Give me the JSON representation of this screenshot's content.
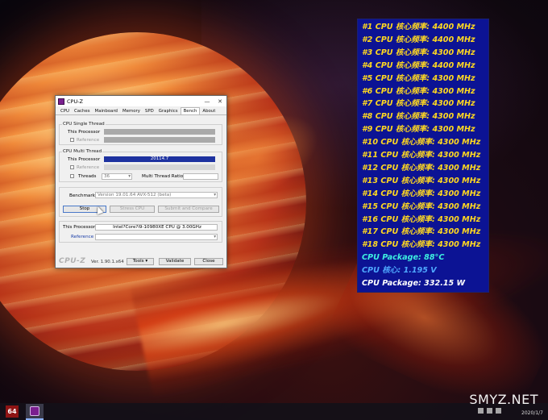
{
  "cpuz": {
    "title": "CPU-Z",
    "tabs": [
      "CPU",
      "Caches",
      "Mainboard",
      "Memory",
      "SPD",
      "Graphics",
      "Bench",
      "About"
    ],
    "active_tab": "Bench",
    "single_thread": {
      "group_title": "CPU Single Thread",
      "this_processor_label": "This Processor",
      "reference_label": "Reference"
    },
    "multi_thread": {
      "group_title": "CPU Multi Thread",
      "this_processor_label": "This Processor",
      "this_processor_value": "20114.7",
      "reference_label": "Reference",
      "threads_label": "Threads",
      "threads_value": "36",
      "ratio_label": "Multi Thread Ratio"
    },
    "benchmark_label": "Benchmark",
    "benchmark_value": "Version 19.01.64 AVX-512 (beta)",
    "stop_button": "Stop",
    "stress_button": "Stress CPU",
    "submit_button": "Submit and Compare",
    "processor_label": "This Processor",
    "processor_value": "Intel?Core?i9-10980XE CPU @ 3.00GHz",
    "reference_label": "Reference",
    "footer": {
      "brand": "CPU-Z",
      "version": "Ver. 1.90.1.x64",
      "tools_button": "Tools",
      "validate_button": "Validate",
      "close_button": "Close"
    }
  },
  "osd": {
    "lines": [
      {
        "text": "#1 CPU 核心频率: 4400 MHz",
        "color": "#ffd820"
      },
      {
        "text": "#2 CPU 核心频率: 4400 MHz",
        "color": "#ffd820"
      },
      {
        "text": "#3 CPU 核心频率: 4300 MHz",
        "color": "#ffd820"
      },
      {
        "text": "#4 CPU 核心频率: 4400 MHz",
        "color": "#ffd820"
      },
      {
        "text": "#5 CPU 核心频率: 4300 MHz",
        "color": "#ffd820"
      },
      {
        "text": "#6 CPU 核心频率: 4300 MHz",
        "color": "#ffd820"
      },
      {
        "text": "#7 CPU 核心频率: 4300 MHz",
        "color": "#ffd820"
      },
      {
        "text": "#8 CPU 核心频率: 4300 MHz",
        "color": "#ffd820"
      },
      {
        "text": "#9 CPU 核心频率: 4300 MHz",
        "color": "#ffd820"
      },
      {
        "text": "#10 CPU 核心频率: 4300 MHz",
        "color": "#ffd820"
      },
      {
        "text": "#11 CPU 核心频率: 4300 MHz",
        "color": "#ffd820"
      },
      {
        "text": "#12 CPU 核心频率: 4300 MHz",
        "color": "#ffd820"
      },
      {
        "text": "#13 CPU 核心频率: 4300 MHz",
        "color": "#ffd820"
      },
      {
        "text": "#14 CPU 核心频率: 4300 MHz",
        "color": "#ffd820"
      },
      {
        "text": "#15 CPU 核心频率: 4300 MHz",
        "color": "#ffd820"
      },
      {
        "text": "#16 CPU 核心频率: 4300 MHz",
        "color": "#ffd820"
      },
      {
        "text": "#17 CPU 核心频率: 4300 MHz",
        "color": "#ffd820"
      },
      {
        "text": "#18 CPU 核心频率: 4300 MHz",
        "color": "#ffd820"
      },
      {
        "text": "CPU Package: 88°C",
        "color": "#3ef0e0"
      },
      {
        "text": "CPU 核心: 1.195 V",
        "color": "#4fa8ff"
      },
      {
        "text": "CPU Package: 332.15 W",
        "color": "#ffffff"
      }
    ]
  },
  "taskbar": {
    "app1_label": "64",
    "date": "2020/1/7"
  },
  "watermark": "SMYZ.NET"
}
